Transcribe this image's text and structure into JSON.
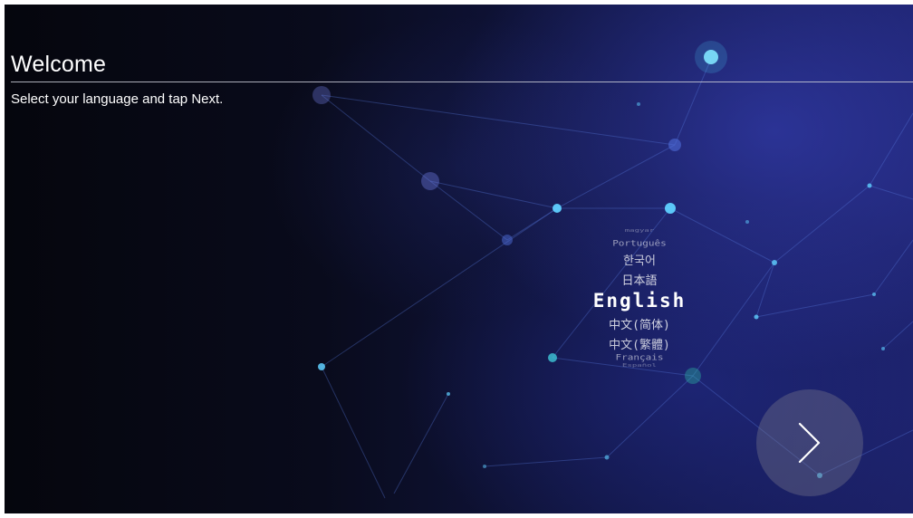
{
  "header": {
    "title": "Welcome",
    "subtitle": "Select your language and tap Next."
  },
  "language_picker": {
    "selected": "English",
    "items_above": [
      "magyar",
      "Português",
      "한국어",
      "日本語"
    ],
    "items_below": [
      "中文(简体)",
      "中文(繁體)",
      "Français",
      "Español"
    ]
  },
  "next_button": {
    "icon": "chevron-right-icon"
  },
  "colors": {
    "accent_glow": "#5fd0ff",
    "background_dark": "#05060d",
    "background_blue": "#1c2168"
  }
}
